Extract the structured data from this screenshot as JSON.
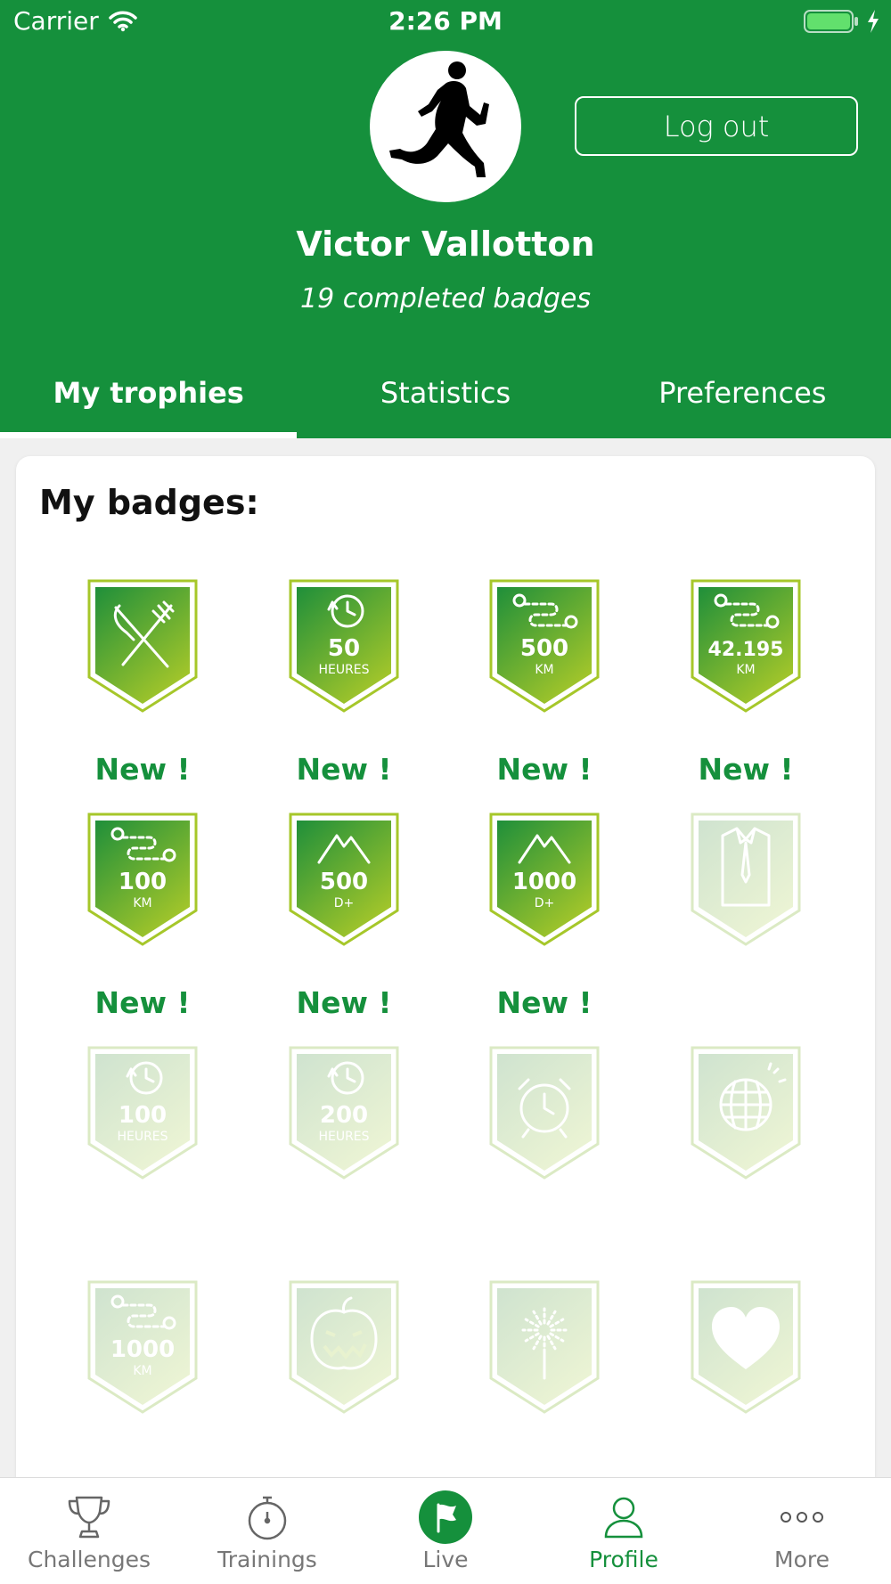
{
  "status_bar": {
    "carrier": "Carrier",
    "time": "2:26 PM"
  },
  "profile": {
    "logout_label": "Log out",
    "name": "Victor Vallotton",
    "badge_count_text": "19 completed badges"
  },
  "tabs": [
    {
      "label": "My trophies",
      "active": true
    },
    {
      "label": "Statistics",
      "active": false
    },
    {
      "label": "Preferences",
      "active": false
    }
  ],
  "badges_section": {
    "title": "My badges:",
    "new_label": "New !",
    "badges": [
      {
        "icon": "fork-knife-icon",
        "value": "",
        "unit": "",
        "earned": true,
        "new": true
      },
      {
        "icon": "clock-icon",
        "value": "50",
        "unit": "HEURES",
        "earned": true,
        "new": true
      },
      {
        "icon": "route-icon",
        "value": "500",
        "unit": "KM",
        "earned": true,
        "new": true
      },
      {
        "icon": "route-icon",
        "value": "42.195",
        "unit": "KM",
        "earned": true,
        "new": true
      },
      {
        "icon": "route-icon",
        "value": "100",
        "unit": "KM",
        "earned": true,
        "new": true
      },
      {
        "icon": "mountain-icon",
        "value": "500",
        "unit": "D+",
        "earned": true,
        "new": true
      },
      {
        "icon": "mountain-icon",
        "value": "1000",
        "unit": "D+",
        "earned": true,
        "new": true
      },
      {
        "icon": "shirt-tie-icon",
        "value": "",
        "unit": "",
        "earned": false,
        "new": false
      },
      {
        "icon": "clock-icon",
        "value": "100",
        "unit": "HEURES",
        "earned": false,
        "new": false
      },
      {
        "icon": "clock-icon",
        "value": "200",
        "unit": "HEURES",
        "earned": false,
        "new": false
      },
      {
        "icon": "alarm-clock-icon",
        "value": "",
        "unit": "",
        "earned": false,
        "new": false
      },
      {
        "icon": "disco-ball-icon",
        "value": "",
        "unit": "",
        "earned": false,
        "new": false
      },
      {
        "icon": "route-icon",
        "value": "1000",
        "unit": "KM",
        "earned": false,
        "new": false
      },
      {
        "icon": "pumpkin-icon",
        "value": "",
        "unit": "",
        "earned": false,
        "new": false
      },
      {
        "icon": "fireworks-icon",
        "value": "",
        "unit": "",
        "earned": false,
        "new": false
      },
      {
        "icon": "heart-icon",
        "value": "",
        "unit": "",
        "earned": false,
        "new": false
      }
    ]
  },
  "tabbar": [
    {
      "label": "Challenges",
      "icon": "trophy-icon",
      "active": false
    },
    {
      "label": "Trainings",
      "icon": "stopwatch-icon",
      "active": false
    },
    {
      "label": "Live",
      "icon": "flag-icon",
      "active": false
    },
    {
      "label": "Profile",
      "icon": "person-icon",
      "active": true
    },
    {
      "label": "More",
      "icon": "more-dots-icon",
      "active": false
    }
  ],
  "colors": {
    "brand_green": "#15903c",
    "badge_light_green": "#a6c72a",
    "tab_inactive": "#777777"
  }
}
